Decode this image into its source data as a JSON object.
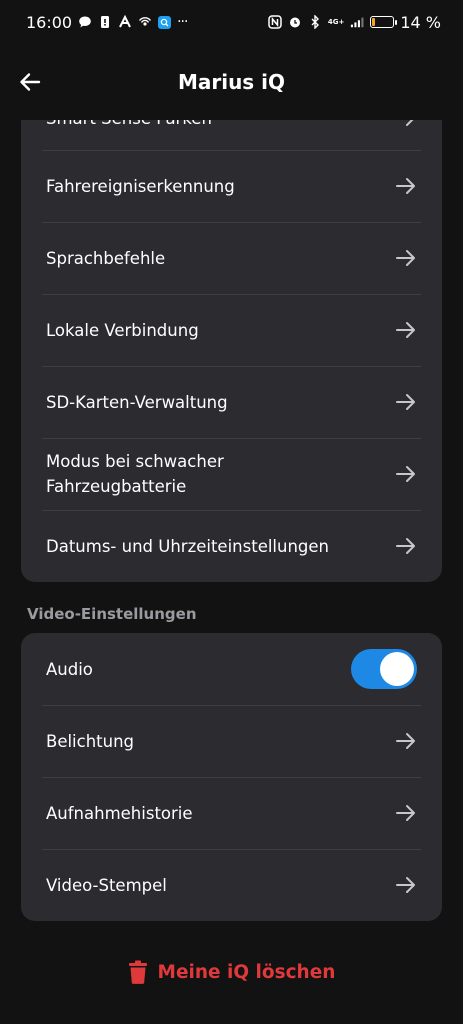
{
  "status_bar": {
    "time": "16:00",
    "left_icons": [
      "message-icon",
      "notification-icon",
      "app-icon",
      "hotspot-icon",
      "app-blue-icon",
      "more-icon"
    ],
    "more": "···",
    "network": "4G+",
    "battery_percent": "14 %",
    "battery_level": 0.14,
    "battery_color": "#f5a623"
  },
  "header": {
    "title": "Marius iQ"
  },
  "general_card": {
    "partial_item": "Smart Sense Parken",
    "items": [
      {
        "label": "Fahrereigniserkennung"
      },
      {
        "label": "Sprachbefehle"
      },
      {
        "label": "Lokale Verbindung"
      },
      {
        "label": "SD-Karten-Verwaltung"
      },
      {
        "label": "Modus bei schwacher Fahrzeugbatterie"
      },
      {
        "label": "Datums- und Uhrzeiteinstellungen"
      }
    ]
  },
  "video_section": {
    "title": "Video-Einstellungen",
    "audio": {
      "label": "Audio",
      "enabled": true,
      "accent": "#1e88e5"
    },
    "items": [
      {
        "label": "Belichtung"
      },
      {
        "label": "Aufnahmehistorie"
      },
      {
        "label": "Video-Stempel"
      }
    ]
  },
  "delete_action": {
    "label": "Meine iQ löschen",
    "color": "#e0393c"
  }
}
